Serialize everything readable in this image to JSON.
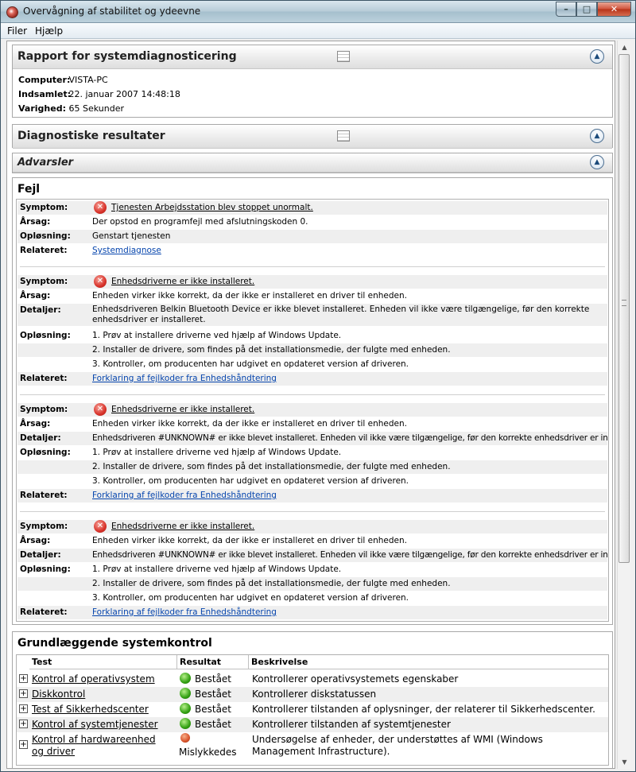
{
  "window": {
    "title": "Overvågning af stabilitet og ydeevne",
    "buttons": {
      "minimize": "–",
      "maximize": "□",
      "close": "✕"
    }
  },
  "menu": [
    "Filer",
    "Hjælp"
  ],
  "report": {
    "title": "Rapport for systemdiagnosticering",
    "rows": [
      {
        "label": "Computer:",
        "value": "VISTA-PC"
      },
      {
        "label": "Indsamlet:",
        "value": "22. januar 2007 14:48:18"
      },
      {
        "label": "Varighed:",
        "value": "65 Sekunder"
      }
    ]
  },
  "diagnostic": {
    "title": "Diagnostiske resultater"
  },
  "warnings": {
    "title": "Advarsler"
  },
  "errors": {
    "title": "Fejl",
    "items": [
      {
        "symptom": "Tjenesten Arbejdsstation blev stoppet unormalt.",
        "cause": "Der opstod en programfejl med afslutningskoden 0.",
        "solution": "Genstart tjenesten",
        "related": "Systemdiagnose"
      },
      {
        "symptom": "Enhedsdriverne er ikke installeret.",
        "cause": "Enheden virker ikke korrekt, da der ikke er installeret en driver til enheden.",
        "details": "Enhedsdriveren Belkin Bluetooth Device er ikke blevet installeret. Enheden vil ikke være tilgængelige, før den korrekte enhedsdriver er installeret.",
        "steps": [
          "1. Prøv at installere driverne ved hjælp af Windows Update.",
          "2. Installer de drivere, som findes på det installationsmedie, der fulgte med enheden.",
          "3. Kontroller, om producenten har udgivet en opdateret version af driveren."
        ],
        "related": "Forklaring af fejlkoder fra Enhedshåndtering"
      },
      {
        "symptom": "Enhedsdriverne er ikke installeret.",
        "cause": "Enheden virker ikke korrekt, da der ikke er installeret en driver til enheden.",
        "details": "Enhedsdriveren #UNKNOWN# er ikke blevet installeret. Enheden vil ikke være tilgængelige, før den korrekte enhedsdriver er installeret.",
        "steps": [
          "1. Prøv at installere driverne ved hjælp af Windows Update.",
          "2. Installer de drivere, som findes på det installationsmedie, der fulgte med enheden.",
          "3. Kontroller, om producenten har udgivet en opdateret version af driveren."
        ],
        "related": "Forklaring af fejlkoder fra Enhedshåndtering"
      },
      {
        "symptom": "Enhedsdriverne er ikke installeret.",
        "cause": "Enheden virker ikke korrekt, da der ikke er installeret en driver til enheden.",
        "details": "Enhedsdriveren #UNKNOWN# er ikke blevet installeret. Enheden vil ikke være tilgængelige, før den korrekte enhedsdriver er installeret.",
        "steps": [
          "1. Prøv at installere driverne ved hjælp af Windows Update.",
          "2. Installer de drivere, som findes på det installationsmedie, der fulgte med enheden.",
          "3. Kontroller, om producenten har udgivet en opdateret version af driveren."
        ],
        "related": "Forklaring af fejlkoder fra Enhedshåndtering"
      }
    ],
    "labels": {
      "symptom": "Symptom:",
      "cause": "Årsag:",
      "details": "Detaljer:",
      "solution": "Opløsning:",
      "related": "Relateret:"
    }
  },
  "basic": {
    "title": "Grundlæggende systemkontrol",
    "headers": [
      "Test",
      "Resultat",
      "Beskrivelse"
    ],
    "rows": [
      {
        "test": "Kontrol af operativsystem",
        "result": "Bestået",
        "status": "ok",
        "desc": "Kontrollerer operativsystemets egenskaber"
      },
      {
        "test": "Diskkontrol",
        "result": "Bestået",
        "status": "ok",
        "desc": "Kontrollerer diskstatussen"
      },
      {
        "test": "Test af Sikkerhedscenter",
        "result": "Bestået",
        "status": "ok",
        "desc": "Kontrollerer tilstanden af oplysninger, der relaterer til Sikkerhedscenter."
      },
      {
        "test": "Kontrol af systemtjenester",
        "result": "Bestået",
        "status": "ok",
        "desc": "Kontrollerer tilstanden af systemtjenester"
      },
      {
        "test": "Kontrol af hardwareenhed og driver",
        "result": "Mislykkedes",
        "status": "bad",
        "desc": "Undersøgelse af enheder, der understøttes af WMI (Windows Management Infrastructure)."
      }
    ]
  },
  "colors": {
    "ok": "#32a012",
    "fail": "#d8522a",
    "link": "#0645ad",
    "error_icon": "#d8322a"
  },
  "icons": {
    "collapse": "▲",
    "expand": "+",
    "error": "✕"
  }
}
